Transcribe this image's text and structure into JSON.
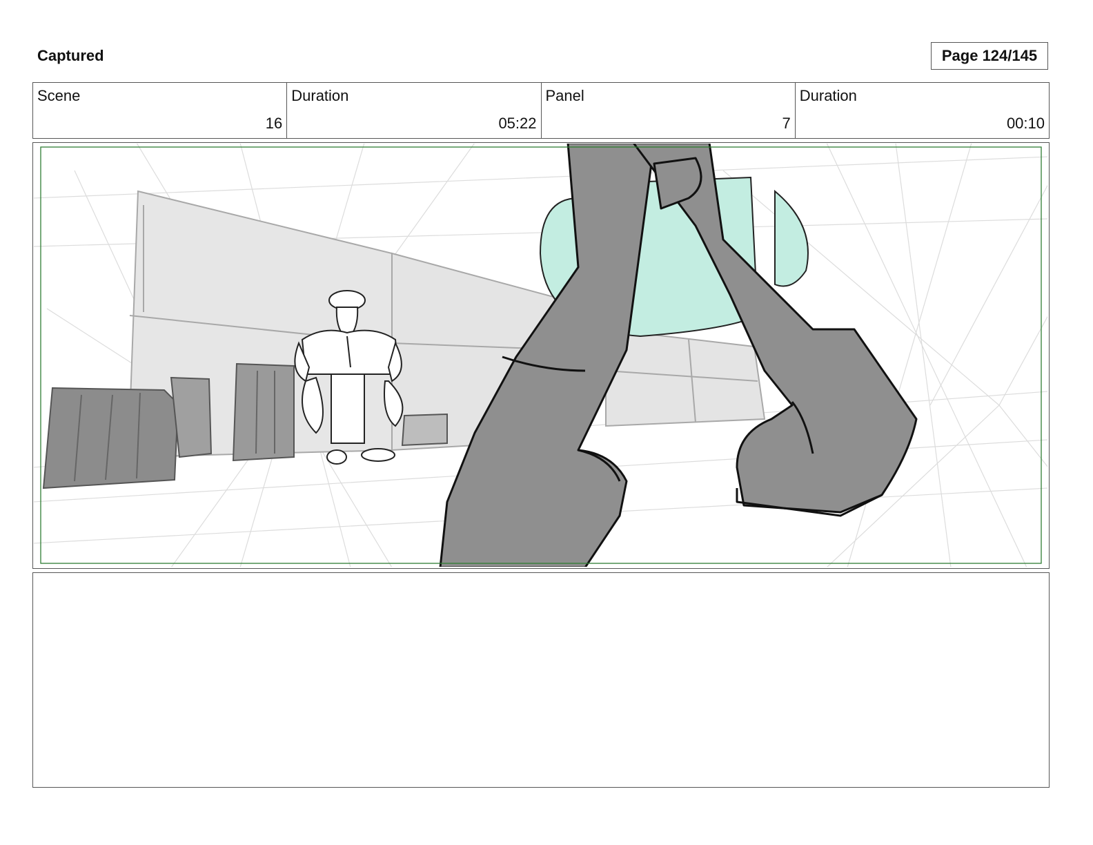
{
  "header": {
    "title": "Captured",
    "page_label": "Page 124/145"
  },
  "info": {
    "scene_label": "Scene",
    "scene_value": "16",
    "scene_duration_label": "Duration",
    "scene_duration_value": "05:22",
    "panel_label": "Panel",
    "panel_value": "7",
    "panel_duration_label": "Duration",
    "panel_duration_value": "00:10"
  },
  "panel": {
    "safe_area_color": "#2e7d32",
    "object_color": "#7f7f7f",
    "accent_color": "#c3ede1",
    "icons": [
      "storyboard-drawing"
    ]
  },
  "notes": {
    "text": ""
  }
}
